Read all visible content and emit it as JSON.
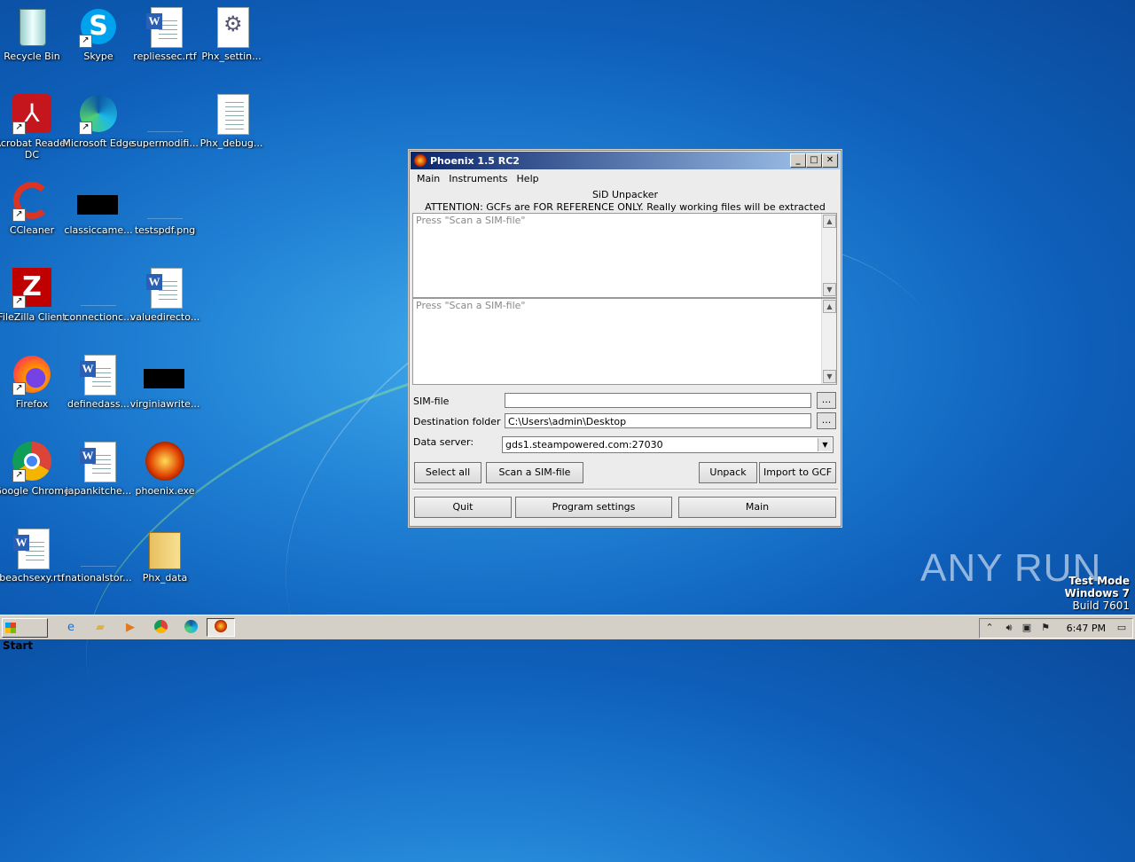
{
  "desktop": {
    "icons": [
      {
        "label": "Recycle Bin",
        "kind": "recycle-bin"
      },
      {
        "label": "Skype",
        "kind": "skype"
      },
      {
        "label": "repliessec.rtf",
        "kind": "word-doc"
      },
      {
        "label": "Phx_settin...",
        "kind": "settings-file"
      },
      {
        "label": "Acrobat Reader DC",
        "kind": "acrobat"
      },
      {
        "label": "Microsoft Edge",
        "kind": "edge"
      },
      {
        "label": "supermodifi...",
        "kind": "blank-file"
      },
      {
        "label": "Phx_debug...",
        "kind": "text-file"
      },
      {
        "label": "CCleaner",
        "kind": "ccleaner"
      },
      {
        "label": "classiccame...",
        "kind": "black-image"
      },
      {
        "label": "testspdf.png",
        "kind": "blank-file"
      },
      {
        "label": "FileZilla Client",
        "kind": "filezilla"
      },
      {
        "label": "connectionc...",
        "kind": "blank-file"
      },
      {
        "label": "valuedirecto...",
        "kind": "word-doc"
      },
      {
        "label": "Firefox",
        "kind": "firefox"
      },
      {
        "label": "definedass...",
        "kind": "word-doc"
      },
      {
        "label": "virginiawrite...",
        "kind": "black-image"
      },
      {
        "label": "Google Chrome",
        "kind": "chrome"
      },
      {
        "label": "japankitche...",
        "kind": "word-doc"
      },
      {
        "label": "phoenix.exe",
        "kind": "phoenix"
      },
      {
        "label": "beachsexy.rtf",
        "kind": "word-doc"
      },
      {
        "label": "nationalstor...",
        "kind": "blank-file"
      },
      {
        "label": "Phx_data",
        "kind": "folder"
      }
    ]
  },
  "window": {
    "title": "Phoenix 1.5 RC2",
    "menu": [
      "Main",
      "Instruments",
      "Help"
    ],
    "heading": "SiD Unpacker",
    "attention": "ATTENTION: GCFs are FOR REFERENCE ONLY. Really working files will be extracted instead!!",
    "list1_placeholder": "Press \"Scan a SIM-file\"",
    "list2_placeholder": "Press \"Scan a SIM-file\"",
    "sim_file_label": "SIM-file",
    "sim_file_value": "",
    "dest_label": "Destination folder",
    "dest_value": "C:\\Users\\admin\\Desktop",
    "server_label": "Data server:",
    "server_value": "gds1.steampowered.com:27030",
    "browse_label": "...",
    "buttons": {
      "select_all": "Select all",
      "scan": "Scan a SIM-file",
      "unpack": "Unpack",
      "import_gcf": "Import to GCF",
      "quit": "Quit",
      "program_settings": "Program settings",
      "main": "Main"
    }
  },
  "taskbar": {
    "start_label": "Start",
    "clock": "6:47 PM"
  },
  "watermark": {
    "line1": "Test Mode",
    "line2": "Windows 7",
    "line3": "Build 7601",
    "brand": "ANY RUN"
  }
}
